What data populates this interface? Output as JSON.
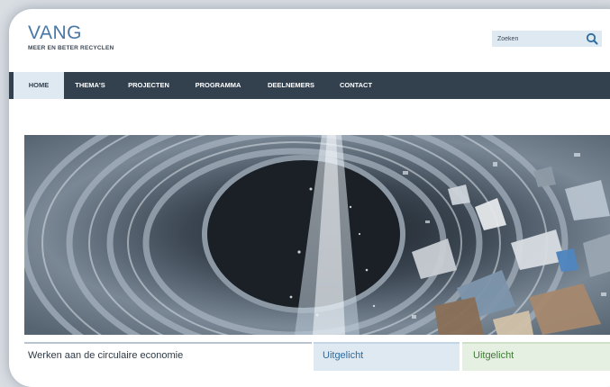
{
  "site": {
    "logo_title": "VANG",
    "logo_subtitle": "MEER EN BETER RECYCLEN"
  },
  "search": {
    "placeholder": "Zoeken",
    "icon": "search-icon"
  },
  "nav": {
    "items": [
      {
        "label": "HOME",
        "active": true
      },
      {
        "label": "THEMA'S",
        "active": false
      },
      {
        "label": "PROJECTEN",
        "active": false
      },
      {
        "label": "PROGRAMMA",
        "active": false
      },
      {
        "label": "DEELNEMERS",
        "active": false
      },
      {
        "label": "CONTACT",
        "active": false
      }
    ]
  },
  "sections": {
    "main_heading": "Werken aan de circulaire economie",
    "featured_1": "Uitgelicht",
    "featured_2": "Uitgelicht"
  },
  "colors": {
    "brand_blue": "#4a78a6",
    "nav_bg": "#33414f",
    "active_tab": "#dfe9f2",
    "featured_green": "#e6f0e2"
  }
}
